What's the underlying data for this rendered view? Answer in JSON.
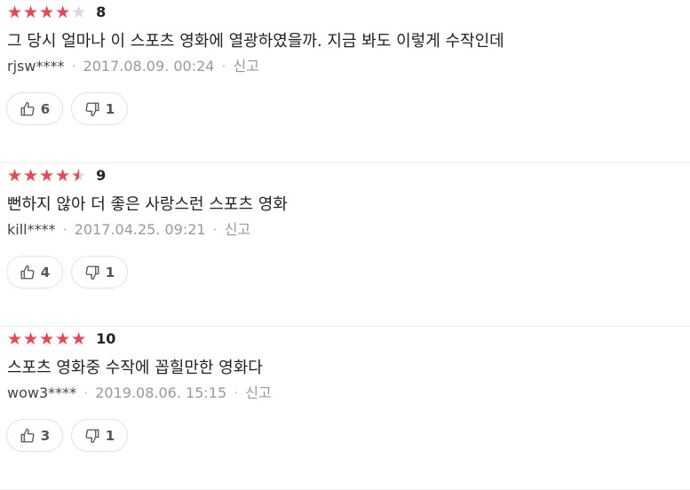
{
  "reviews": [
    {
      "rating": 4,
      "score": "8",
      "comment": "그 당시 얼마나 이 스포츠 영화에 열광하였을까. 지금 봐도 이렇게 수작인데",
      "user": "rjsw****",
      "date": "2017.08.09. 00:24",
      "report_label": "신고",
      "likes": "6",
      "dislikes": "1"
    },
    {
      "rating": 4.5,
      "score": "9",
      "comment": "뻔하지 않아 더 좋은 사랑스런 스포츠 영화",
      "user": "kill****",
      "date": "2017.04.25. 09:21",
      "report_label": "신고",
      "likes": "4",
      "dislikes": "1"
    },
    {
      "rating": 5,
      "score": "10",
      "comment": "스포츠 영화중 수작에 꼽힐만한 영화다",
      "user": "wow3****",
      "date": "2019.08.06. 15:15",
      "report_label": "신고",
      "likes": "3",
      "dislikes": "1"
    }
  ],
  "colors": {
    "star_filled": "#f0444e",
    "star_empty": "#d9d9d9"
  },
  "icons": {
    "like": "thumbs-up-icon",
    "dislike": "thumbs-down-icon"
  }
}
